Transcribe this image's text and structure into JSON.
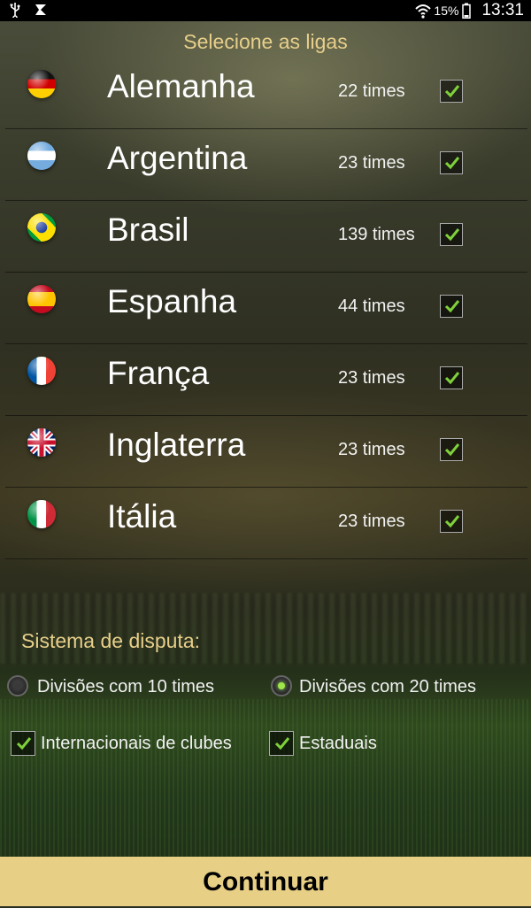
{
  "statusbar": {
    "left_icons": [
      "usb-icon",
      "app-notification-icon"
    ],
    "wifi_icon": "wifi-icon",
    "battery_percent": "15%",
    "battery_icon": "battery-icon",
    "time": "13:31"
  },
  "title": "Selecione as ligas",
  "leagues": [
    {
      "name": "Alemanha",
      "teams": "22 times",
      "flag": "germany-flag-icon",
      "checked": true
    },
    {
      "name": "Argentina",
      "teams": "23 times",
      "flag": "argentina-flag-icon",
      "checked": true
    },
    {
      "name": "Brasil",
      "teams": "139 times",
      "flag": "brazil-flag-icon",
      "checked": true
    },
    {
      "name": "Espanha",
      "teams": "44 times",
      "flag": "spain-flag-icon",
      "checked": true
    },
    {
      "name": "França",
      "teams": "23 times",
      "flag": "france-flag-icon",
      "checked": true
    },
    {
      "name": "Inglaterra",
      "teams": "23 times",
      "flag": "england-flag-icon",
      "checked": true
    },
    {
      "name": "Itália",
      "teams": "23 times",
      "flag": "italy-flag-icon",
      "checked": true
    }
  ],
  "system": {
    "label": "Sistema de disputa:",
    "options": [
      {
        "label": "Divisões com 10 times",
        "selected": false
      },
      {
        "label": "Divisões com 20 times",
        "selected": true
      }
    ]
  },
  "extras": [
    {
      "label": "Internacionais de clubes",
      "checked": true
    },
    {
      "label": "Estaduais",
      "checked": true
    }
  ],
  "continue_label": "Continuar",
  "colors": {
    "accent": "#e7cf8a",
    "check_green": "#7fd13b",
    "button_bg": "#e8cf86"
  }
}
